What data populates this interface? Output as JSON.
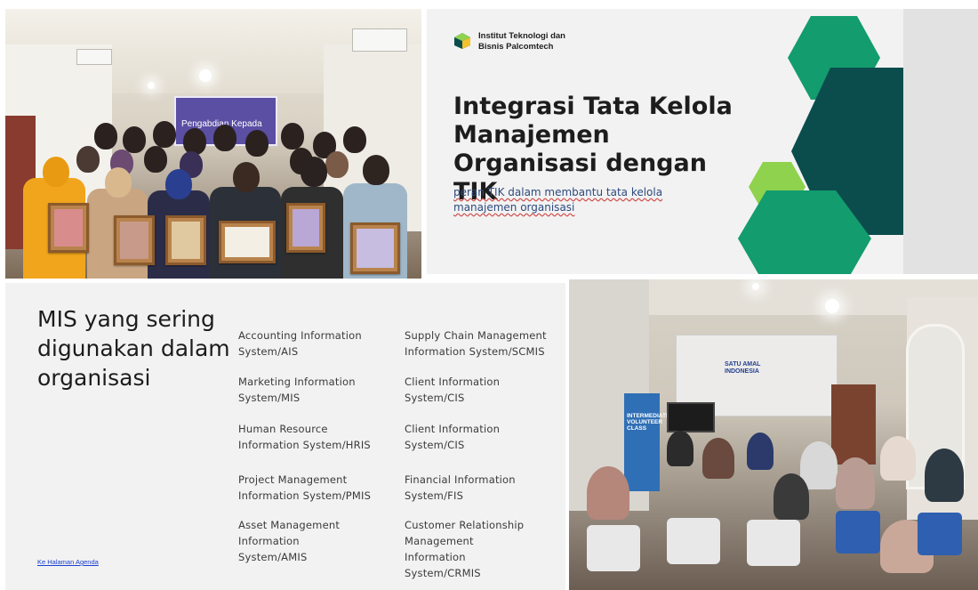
{
  "photo_top": {
    "banner_text": "Pengabdian Kepada"
  },
  "title_slide": {
    "institution": "Institut Teknologi dan Bisnis Palcomtech",
    "title": "Integrasi Tata Kelola Manajemen Organisasi dengan TIK",
    "subtitle": "peran TIK dalam membantu tata kelola manajemen organisasi",
    "colors": {
      "dark_teal": "#0b4d4d",
      "green": "#139c6e",
      "light_green": "#8fd24e"
    }
  },
  "mis_slide": {
    "title": "MIS yang sering digunakan dalam organisasi",
    "items_left": [
      "Accounting Information System/AIS",
      "Marketing Information System/MIS",
      "Human Resource Information System/HRIS",
      "Project Management Information System/PMIS",
      "Asset Management Information System/AMIS"
    ],
    "items_right": [
      "Supply Chain Management Information System/SCMIS",
      "Client Information System/CIS",
      "Client Information System/CIS",
      "Financial Information System/FIS",
      "Customer Relationship Management Information System/CRMIS"
    ],
    "link_text": "Ke Halaman Agenda"
  },
  "photo_bottom": {
    "banner_text": "SATU AMAL INDONESIA",
    "standee_text": "INTERMEDIATE VOLUNTEER CLASS"
  }
}
